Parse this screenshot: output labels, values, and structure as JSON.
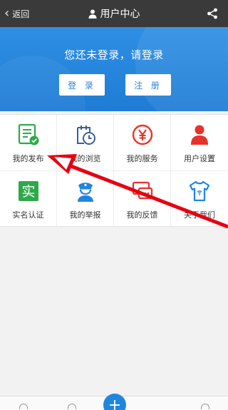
{
  "topbar": {
    "back_label": "返回",
    "title": "用户中心"
  },
  "banner": {
    "message": "您还未登录，请登录",
    "login_label": "登 录",
    "register_label": "注 册"
  },
  "grid": {
    "items": [
      {
        "label": "我的发布",
        "icon": "document-check-icon"
      },
      {
        "label": "我的浏览",
        "icon": "calendar-clock-icon"
      },
      {
        "label": "我的服务",
        "icon": "yen-circle-icon"
      },
      {
        "label": "用户设置",
        "icon": "user-icon"
      },
      {
        "label": "实名认证",
        "icon": "verify-icon"
      },
      {
        "label": "我的举报",
        "icon": "police-icon"
      },
      {
        "label": "我的反馈",
        "icon": "feedback-icon"
      },
      {
        "label": "关于我们",
        "icon": "tshirt-icon"
      }
    ]
  },
  "verify_char": "实",
  "colors": {
    "topbar": "#3a3a3a",
    "banner": "#2b86e0",
    "accent_red": "#e5332c",
    "green": "#2ea94a",
    "blue": "#1f86e0"
  }
}
